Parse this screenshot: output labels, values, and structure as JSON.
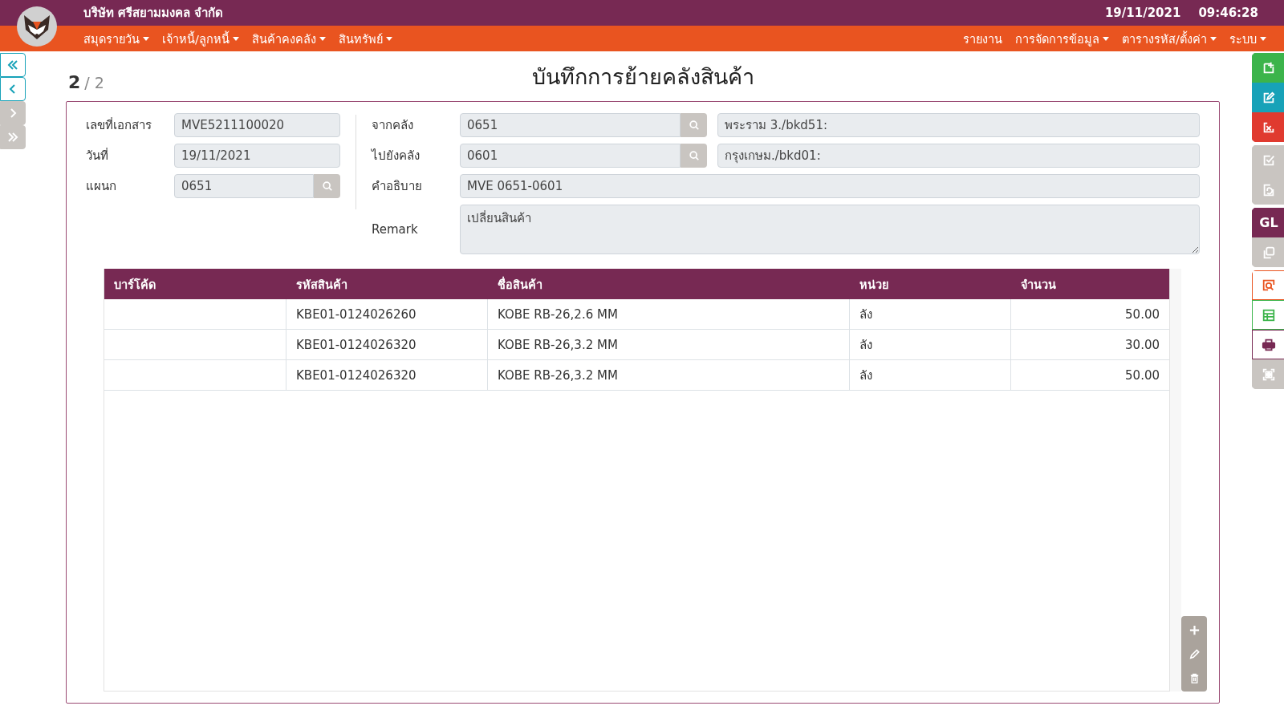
{
  "header": {
    "company": "บริษัท ศรีสยามมงคล จำกัด",
    "date": "19/11/2021",
    "time": "09:46:28"
  },
  "menu_left": [
    {
      "label": "สมุดรายวัน",
      "dropdown": true
    },
    {
      "label": "เจ้าหนี้/ลูกหนี้",
      "dropdown": true
    },
    {
      "label": "สินค้าคงคลัง",
      "dropdown": true
    },
    {
      "label": "สินทรัพย์",
      "dropdown": true
    }
  ],
  "menu_right": [
    {
      "label": "รายงาน",
      "dropdown": false
    },
    {
      "label": "การจัดการข้อมูล",
      "dropdown": true
    },
    {
      "label": "ตารางรหัส/ตั้งค่า",
      "dropdown": true
    },
    {
      "label": "ระบบ",
      "dropdown": true
    }
  ],
  "nav_buttons": [
    {
      "kind": "first",
      "disabled": false
    },
    {
      "kind": "prev",
      "disabled": false
    },
    {
      "kind": "next",
      "disabled": true
    },
    {
      "kind": "last",
      "disabled": true
    }
  ],
  "record": {
    "current": "2",
    "of": "/ 2"
  },
  "title": "บันทึกการย้ายคลังสินค้า",
  "form_left": [
    {
      "label": "เลขที่เอกสาร",
      "value": "MVE5211100020",
      "lookup": false
    },
    {
      "label": "วันที่",
      "value": "19/11/2021",
      "lookup": false
    },
    {
      "label": "แผนก",
      "value": "0651",
      "lookup": true
    }
  ],
  "form_right": [
    {
      "label": "จากคลัง",
      "value": "0651",
      "lookup": true,
      "name": "พระราม 3./bkd51:"
    },
    {
      "label": "ไปยังคลัง",
      "value": "0601",
      "lookup": true,
      "name": "กรุงเกษม./bkd01:"
    },
    {
      "label": "คำอธิบาย",
      "value": "MVE 0651-0601",
      "lookup": false
    }
  ],
  "remark": {
    "label": "Remark",
    "value": "เปลี่ยนสินค้า"
  },
  "table": {
    "columns": [
      "บาร์โค้ด",
      "รหัสสินค้า",
      "ชื่อสินค้า",
      "หน่วย",
      "จำนวน"
    ],
    "rows": [
      {
        "code": "KBE01-0124026260",
        "name": "KOBE RB-26,2.6 MM",
        "unit": "ลัง",
        "quantity": "50.00"
      },
      {
        "code": "KBE01-0124026320",
        "name": "KOBE RB-26,3.2 MM",
        "unit": "ลัง",
        "quantity": "30.00"
      },
      {
        "code": "KBE01-0124026320",
        "name": "KOBE RB-26,3.2 MM",
        "unit": "ลัง",
        "quantity": "50.00"
      }
    ]
  },
  "row_tools": [
    {
      "kind": "add"
    },
    {
      "kind": "edit"
    },
    {
      "kind": "delete"
    }
  ],
  "toolbar": [
    {
      "buttons": [
        {
          "kind": "add",
          "color": "#3cb44b",
          "disabled": false
        },
        {
          "kind": "edit",
          "color": "#17a2b8",
          "disabled": false
        },
        {
          "kind": "cancel",
          "color": "#e03a2f",
          "disabled": false
        }
      ]
    },
    {
      "buttons": [
        {
          "kind": "approve",
          "disabled": true
        },
        {
          "kind": "restore",
          "disabled": true
        }
      ]
    },
    {
      "buttons": [
        {
          "kind": "gl",
          "label": "GL",
          "color": "#772953",
          "disabled": false
        },
        {
          "kind": "copy",
          "disabled": true
        }
      ]
    },
    {
      "buttons": [
        {
          "kind": "preview",
          "color": "#e95420",
          "disabled": false
        },
        {
          "kind": "sheet",
          "color": "#3cb44b",
          "disabled": false
        },
        {
          "kind": "print",
          "color": "#772953",
          "disabled": false
        },
        {
          "kind": "scan",
          "disabled": true
        }
      ]
    }
  ]
}
